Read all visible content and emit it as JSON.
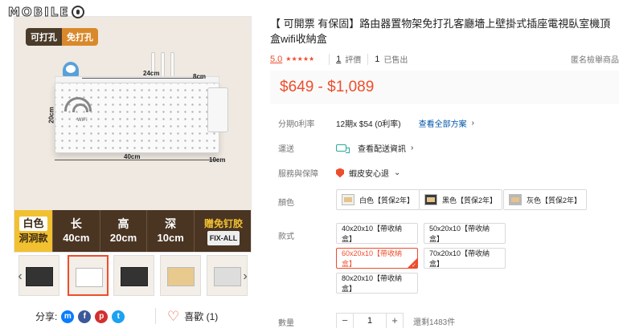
{
  "watermark": "MOBILE",
  "gallery": {
    "tags": [
      "可打孔",
      "免打孔"
    ],
    "dims": {
      "top": "24cm",
      "cup": "8cm",
      "side": "20cm",
      "bottom": "40cm",
      "depth": "10cm"
    },
    "wifi_label": "WiFi",
    "specs": [
      {
        "top": "白色",
        "bottom": "洞洞款"
      },
      {
        "top": "长",
        "bottom": "40cm"
      },
      {
        "top": "高",
        "bottom": "20cm"
      },
      {
        "top": "深",
        "bottom": "10cm"
      },
      {
        "top": "赠免钉胶",
        "bottom": "FIX-ALL"
      }
    ]
  },
  "share": {
    "label": "分享:"
  },
  "like": {
    "label": "喜歡 (1)"
  },
  "product": {
    "title": "【 可開票 有保固】路由器置物架免打孔客廳墻上壁掛式插座電視臥室機頂盒wifi收納盒",
    "rating": "5.0",
    "stars": "★★★★★",
    "reviews_count": "1",
    "reviews_label": "評價",
    "sold_count": "1",
    "sold_label": "已售出",
    "report": "匿名檢舉商品",
    "price": "$649 - $1,089"
  },
  "rows": {
    "installment": {
      "label": "分期0利率",
      "value": "12期x $54 (0利率)",
      "link": "查看全部方案"
    },
    "shipping": {
      "label": "運送",
      "link": "查看配送資訊"
    },
    "guarantee": {
      "label": "服務與保障",
      "value": "蝦皮安心退"
    },
    "color": {
      "label": "顏色",
      "options": [
        "白色【質保2年】",
        "黑色【質保2年】",
        "灰色【質保2年】"
      ]
    },
    "style": {
      "label": "款式",
      "options": [
        "40x20x10【帶收納盒】",
        "50x20x10【帶收納盒】",
        "60x20x10【帶收納盒】",
        "70x20x10【帶收納盒】",
        "80x20x10【帶收納盒】"
      ],
      "selected": "60x20x10【帶收納盒】"
    },
    "quantity": {
      "label": "數量",
      "value": "1",
      "minus": "−",
      "plus": "+",
      "stock": "還剩1483件"
    }
  },
  "colors": {
    "accent": "#ee4d2d",
    "link": "#0055aa",
    "teal": "#26aa99"
  }
}
